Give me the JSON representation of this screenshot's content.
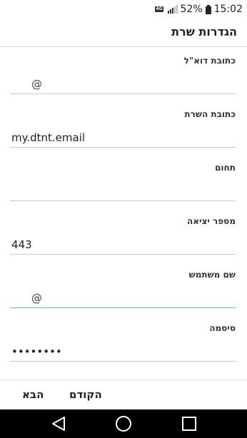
{
  "status": {
    "network_label": "4G",
    "battery_percent": "52%",
    "time": "15:02",
    "icons": [
      "network-4g-icon",
      "signal-icon",
      "battery-icon"
    ]
  },
  "header": {
    "title": "הגדרות שרת"
  },
  "fields": [
    {
      "label": "כתובת דוא\"ל",
      "value": "",
      "prefix": "@"
    },
    {
      "label": "כתובת השרת",
      "value": "my.dtnt.email"
    },
    {
      "label": "תחום",
      "value": ""
    },
    {
      "label": "מספר יציאה",
      "value": "443"
    },
    {
      "label": "שם משתמש",
      "value": "",
      "prefix": "@",
      "focused": true
    },
    {
      "label": "סיסמה",
      "value": "••••••••"
    }
  ],
  "actions": {
    "next_label": "הבא",
    "prev_label": "הקודם"
  },
  "navbar": {
    "icons": [
      "back-icon",
      "home-icon",
      "recent-apps-icon"
    ]
  },
  "colors": {
    "focus_underline": "#4fc3b6",
    "navbar_bg": "#000000"
  }
}
